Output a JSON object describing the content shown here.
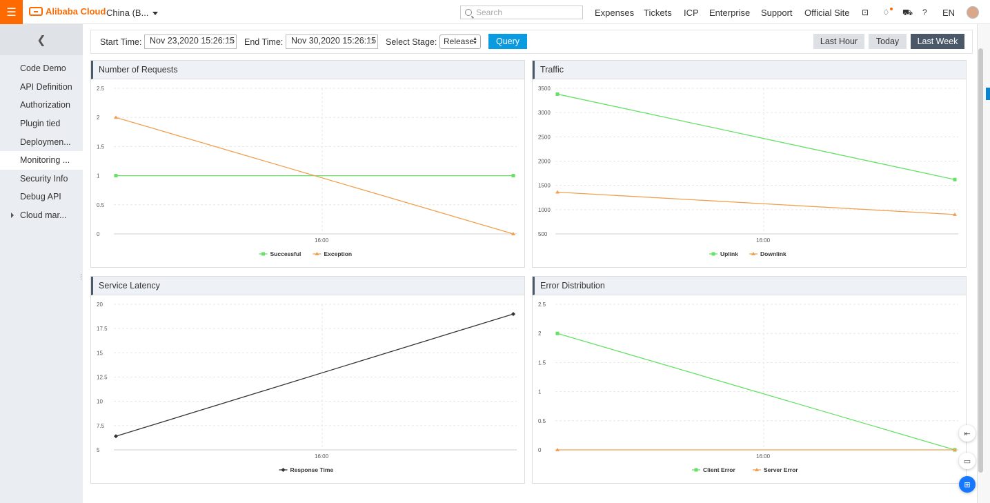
{
  "topbar": {
    "menu_icon": "hamburger-icon",
    "logo_text": "Alibaba Cloud",
    "region": "China (B...",
    "search_placeholder": "Search",
    "nav": [
      "Expenses",
      "Tickets",
      "ICP",
      "Enterprise",
      "Support",
      "Official Site"
    ],
    "language": "EN",
    "icons": [
      "terminal-icon",
      "bell-icon",
      "cart-icon",
      "help-icon"
    ]
  },
  "sidebar": {
    "back_icon": "chevron-left-icon",
    "items": [
      {
        "label": "Code Demo"
      },
      {
        "label": "API Definition"
      },
      {
        "label": "Authorization"
      },
      {
        "label": "Plugin tied"
      },
      {
        "label": "Deploymen..."
      },
      {
        "label": "Monitoring ...",
        "active": true
      },
      {
        "label": "Security Info"
      },
      {
        "label": "Debug API"
      },
      {
        "label": "Cloud mar...",
        "expandable": true
      }
    ]
  },
  "filter": {
    "start_label": "Start Time:",
    "start_value": "Nov 23,2020 15:26:15",
    "end_label": "End Time:",
    "end_value": "Nov 30,2020 15:26:15",
    "stage_label": "Select Stage:",
    "stage_value": "Release",
    "query_label": "Query",
    "ranges": [
      "Last Hour",
      "Today",
      "Last Week"
    ],
    "selected_range": "Last Week"
  },
  "colors": {
    "green": "#66e066",
    "orange": "#f0a050",
    "dark": "#333333",
    "query_blue": "#0a9ae0",
    "accent_orange": "#ff6a00"
  },
  "panels": {
    "requests_title": "Number of Requests",
    "traffic_title": "Traffic",
    "latency_title": "Service Latency",
    "errors_title": "Error Distribution"
  },
  "chart_data": [
    {
      "type": "line",
      "title": "Number of Requests",
      "x_tick": "16:00",
      "ylim": [
        0,
        2.5
      ],
      "yticks": [
        "0",
        "0.5",
        "1",
        "1.5",
        "2",
        "2.5"
      ],
      "series": [
        {
          "name": "Successful",
          "values": [
            1,
            1
          ],
          "color": "#66e066"
        },
        {
          "name": "Exception",
          "values": [
            2,
            0
          ],
          "color": "#f0a050"
        }
      ]
    },
    {
      "type": "line",
      "title": "Traffic",
      "x_tick": "16:00",
      "ylim": [
        500,
        3500
      ],
      "yticks": [
        "500",
        "1000",
        "1500",
        "2000",
        "2500",
        "3000",
        "3500"
      ],
      "series": [
        {
          "name": "Uplink",
          "values": [
            3380,
            1620
          ],
          "color": "#66e066"
        },
        {
          "name": "Downlink",
          "values": [
            1360,
            900
          ],
          "color": "#f0a050"
        }
      ]
    },
    {
      "type": "line",
      "title": "Service Latency",
      "x_tick": "16:00",
      "ylim": [
        5,
        20
      ],
      "yticks": [
        "5",
        "7.5",
        "10",
        "12.5",
        "15",
        "17.5",
        "20"
      ],
      "series": [
        {
          "name": "Response Time",
          "values": [
            6.4,
            19
          ],
          "color": "#333333"
        }
      ]
    },
    {
      "type": "line",
      "title": "Error Distribution",
      "x_tick": "16:00",
      "ylim": [
        0,
        2.5
      ],
      "yticks": [
        "0",
        "0.5",
        "1",
        "1.5",
        "2",
        "2.5"
      ],
      "series": [
        {
          "name": "Client Error",
          "values": [
            2,
            0
          ],
          "color": "#66e066"
        },
        {
          "name": "Server Error",
          "values": [
            0,
            0
          ],
          "color": "#f0a050"
        }
      ]
    }
  ],
  "right_edge": {
    "float_icons": [
      "collapse-panel-icon",
      "chat-icon",
      "apps-icon"
    ]
  }
}
